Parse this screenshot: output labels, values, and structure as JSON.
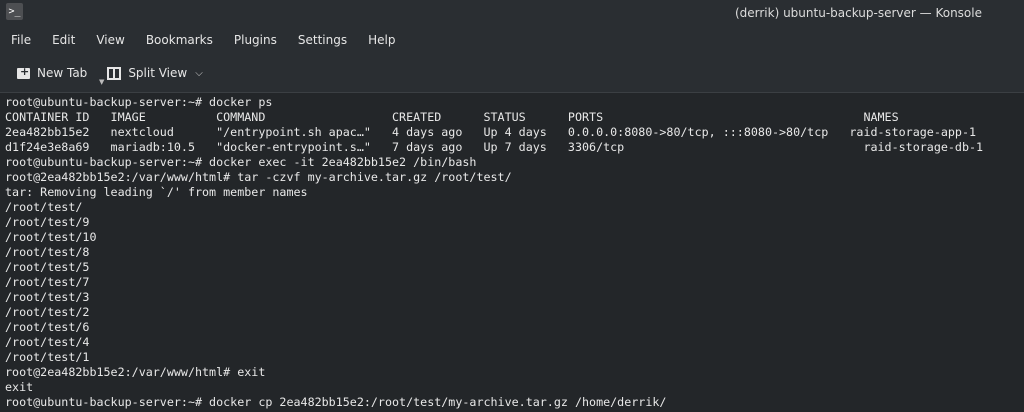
{
  "window": {
    "title": "(derrik) ubuntu-backup-server — Konsole",
    "icon": "terminal-icon"
  },
  "menu": [
    "File",
    "Edit",
    "View",
    "Bookmarks",
    "Plugins",
    "Settings",
    "Help"
  ],
  "toolbar": {
    "new_tab": "New Tab",
    "split_view": "Split View"
  },
  "terminal": {
    "lines": [
      "root@ubuntu-backup-server:~# docker ps",
      "CONTAINER ID   IMAGE          COMMAND                  CREATED      STATUS      PORTS                                     NAMES",
      "2ea482bb15e2   nextcloud      \"/entrypoint.sh apac…\"   4 days ago   Up 4 days   0.0.0.0:8080->80/tcp, :::8080->80/tcp   raid-storage-app-1",
      "d1f24e3e8a69   mariadb:10.5   \"docker-entrypoint.s…\"   7 days ago   Up 7 days   3306/tcp                                  raid-storage-db-1",
      "root@ubuntu-backup-server:~# docker exec -it 2ea482bb15e2 /bin/bash",
      "root@2ea482bb15e2:/var/www/html# tar -czvf my-archive.tar.gz /root/test/",
      "tar: Removing leading `/' from member names",
      "/root/test/",
      "/root/test/9",
      "/root/test/10",
      "/root/test/8",
      "/root/test/5",
      "/root/test/7",
      "/root/test/3",
      "/root/test/2",
      "/root/test/6",
      "/root/test/4",
      "/root/test/1",
      "root@2ea482bb15e2:/var/www/html# exit",
      "exit",
      "root@ubuntu-backup-server:~# docker cp 2ea482bb15e2:/root/test/my-archive.tar.gz /home/derrik/"
    ]
  }
}
